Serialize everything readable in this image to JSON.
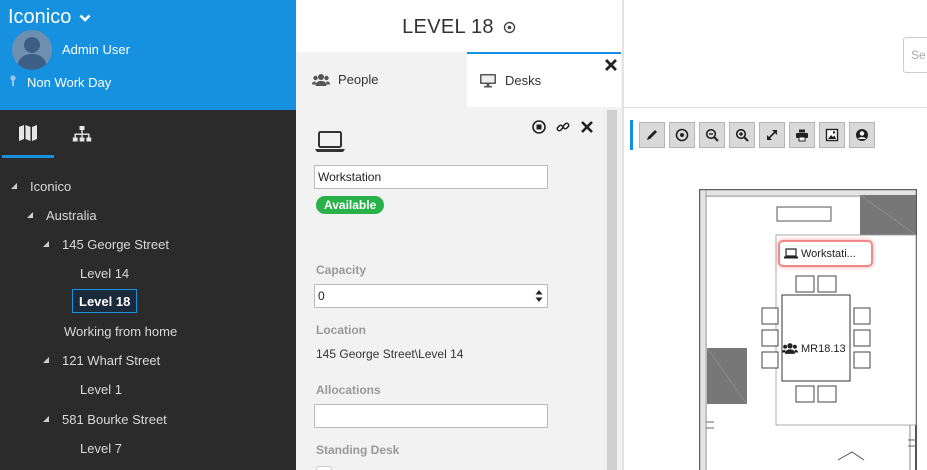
{
  "sidebar": {
    "org_name": "Iconico",
    "user_name": "Admin User",
    "status": "Non Work Day",
    "tree": [
      {
        "label": "Iconico"
      },
      {
        "label": "Australia"
      },
      {
        "label": "145 George Street"
      },
      {
        "label": "Level 14"
      },
      {
        "label": "Level 18"
      },
      {
        "label": "Working from home"
      },
      {
        "label": "121 Wharf Street"
      },
      {
        "label": "Level 1"
      },
      {
        "label": "581 Bourke Street"
      },
      {
        "label": "Level 7"
      }
    ],
    "selected_item": "Level 18"
  },
  "panel": {
    "level_title": "LEVEL 18",
    "tabs": [
      {
        "label": "People"
      },
      {
        "label": "Desks"
      }
    ],
    "active_tab": "Desks",
    "desk": {
      "name": "Workstation",
      "status": "Available",
      "status_color": "#29b24a",
      "capacity_label": "Capacity",
      "capacity_value": "0",
      "location_label": "Location",
      "location_value": "145 George Street\\Level 14",
      "allocations_label": "Allocations",
      "allocations_value": "",
      "standing_desk_label": "Standing Desk"
    }
  },
  "map": {
    "search_placeholder": "Se",
    "toolbar": [
      "edit-icon",
      "target-icon",
      "zoom-out-icon",
      "zoom-in-icon",
      "fullscreen-icon",
      "print-icon",
      "image-icon",
      "user-icon"
    ],
    "workstation_label": "Workstati...",
    "room_label": "MR18.13"
  },
  "colors": {
    "accent": "#1591e0",
    "sidebar_bg": "#2b2b2b",
    "available": "#29b24a"
  }
}
